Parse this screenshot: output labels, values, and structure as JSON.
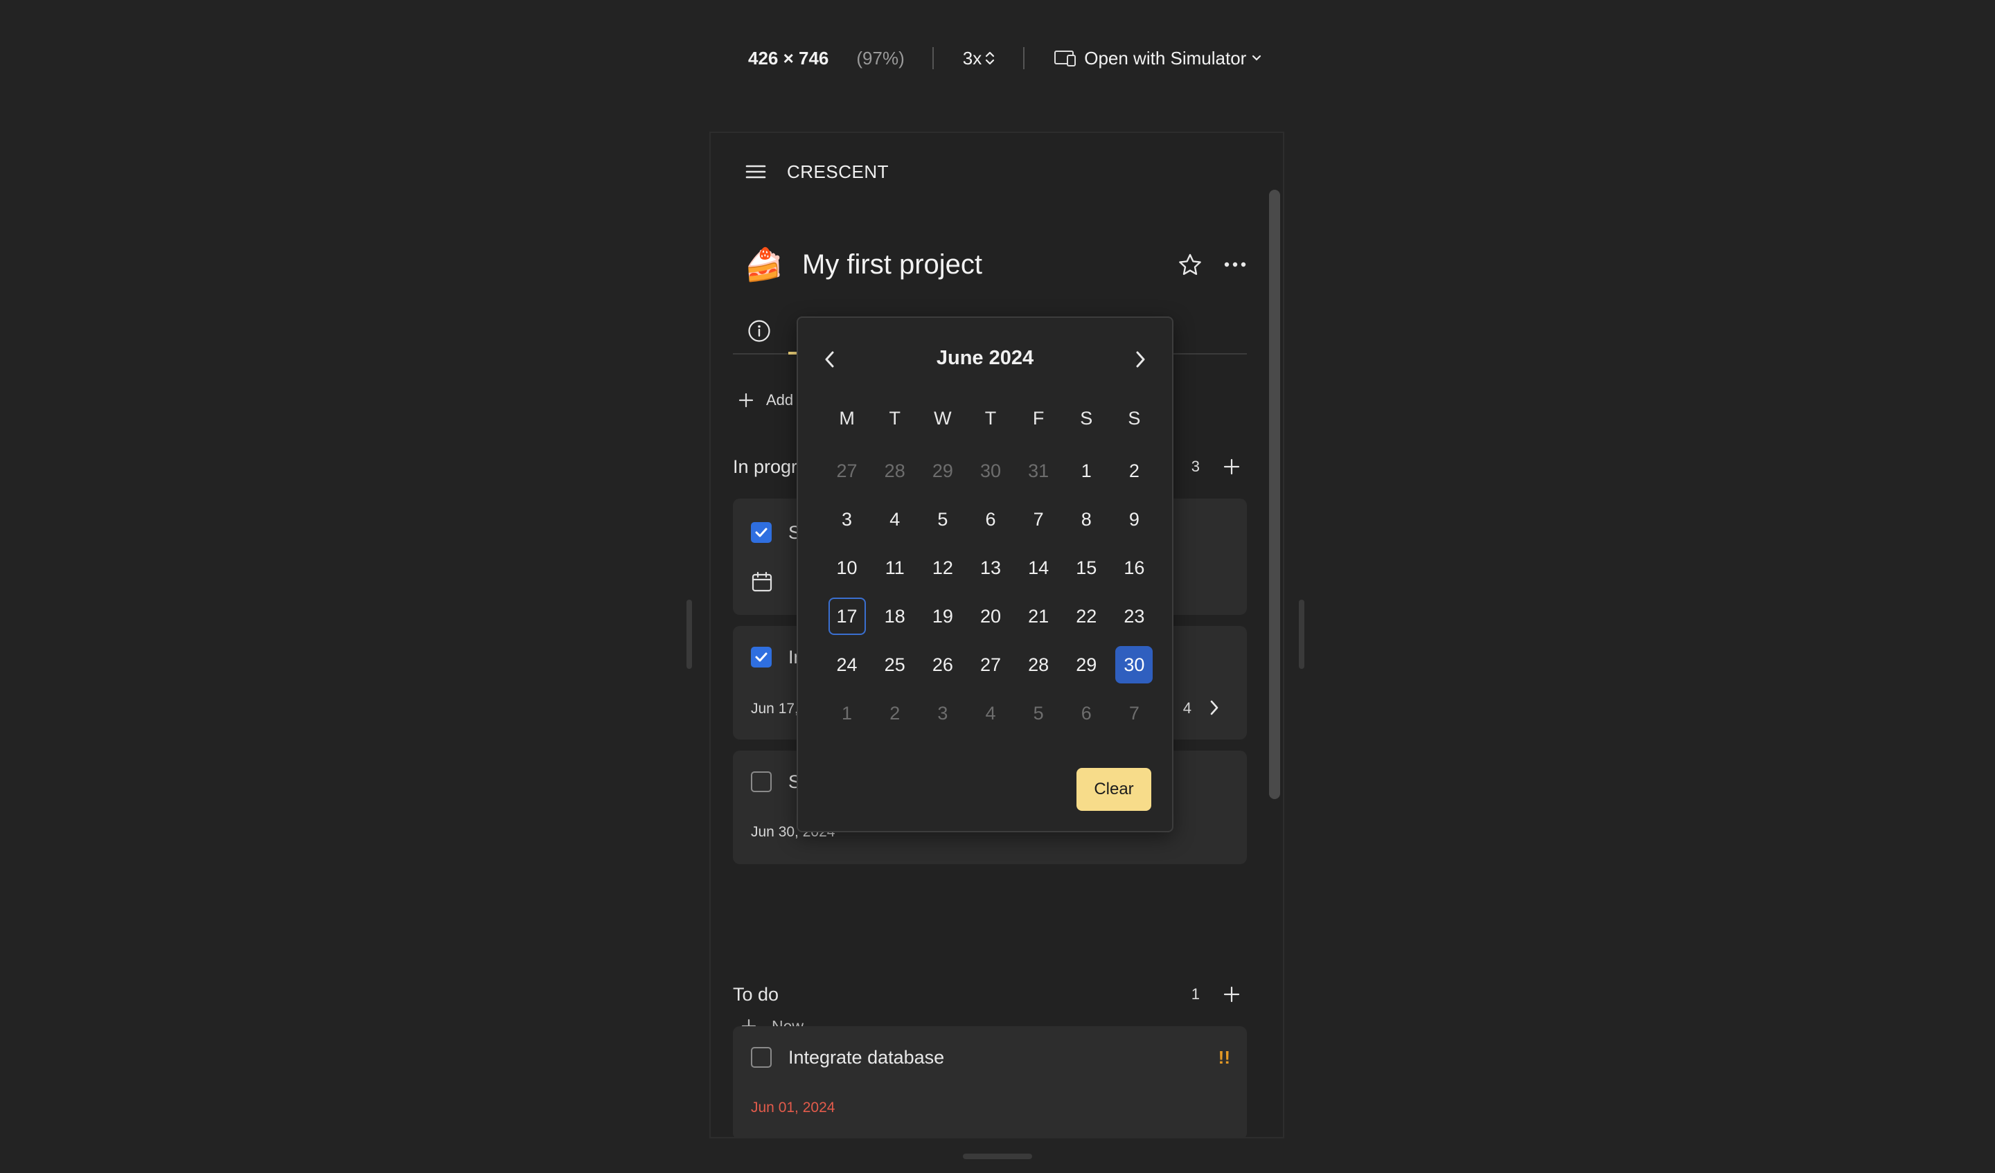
{
  "toolbar": {
    "dimensions": "426 × 746",
    "zoom": "(97%)",
    "scale": "3x",
    "open_with": "Open with Simulator"
  },
  "app": {
    "title": "CRESCENT"
  },
  "project": {
    "emoji": "🍰",
    "title": "My first project"
  },
  "add_row": {
    "label": "Add"
  },
  "sections": [
    {
      "title": "In progr",
      "count": "3",
      "cards": [
        {
          "title": "S",
          "checked": true,
          "date": ""
        },
        {
          "title": "In",
          "checked": true,
          "date": "Jun 17,",
          "subtask_count": "4"
        },
        {
          "title": "S",
          "checked": false,
          "date": "Jun 30, 2024"
        }
      ],
      "new_label": "New"
    },
    {
      "title": "To do",
      "count": "1",
      "cards": [
        {
          "title": "Integrate database",
          "checked": false,
          "date": "Jun 01, 2024",
          "priority": "!!"
        }
      ]
    }
  ],
  "datepicker": {
    "month": "June 2024",
    "weekdays": [
      "M",
      "T",
      "W",
      "T",
      "F",
      "S",
      "S"
    ],
    "days": [
      {
        "d": "27",
        "muted": true
      },
      {
        "d": "28",
        "muted": true
      },
      {
        "d": "29",
        "muted": true
      },
      {
        "d": "30",
        "muted": true
      },
      {
        "d": "31",
        "muted": true
      },
      {
        "d": "1"
      },
      {
        "d": "2"
      },
      {
        "d": "3"
      },
      {
        "d": "4"
      },
      {
        "d": "5"
      },
      {
        "d": "6"
      },
      {
        "d": "7"
      },
      {
        "d": "8"
      },
      {
        "d": "9"
      },
      {
        "d": "10"
      },
      {
        "d": "11"
      },
      {
        "d": "12"
      },
      {
        "d": "13"
      },
      {
        "d": "14"
      },
      {
        "d": "15"
      },
      {
        "d": "16"
      },
      {
        "d": "17",
        "today": true
      },
      {
        "d": "18"
      },
      {
        "d": "19"
      },
      {
        "d": "20"
      },
      {
        "d": "21"
      },
      {
        "d": "22"
      },
      {
        "d": "23"
      },
      {
        "d": "24"
      },
      {
        "d": "25"
      },
      {
        "d": "26"
      },
      {
        "d": "27"
      },
      {
        "d": "28"
      },
      {
        "d": "29"
      },
      {
        "d": "30",
        "selected": true
      },
      {
        "d": "1",
        "muted": true
      },
      {
        "d": "2",
        "muted": true
      },
      {
        "d": "3",
        "muted": true
      },
      {
        "d": "4",
        "muted": true
      },
      {
        "d": "5",
        "muted": true
      },
      {
        "d": "6",
        "muted": true
      },
      {
        "d": "7",
        "muted": true
      }
    ],
    "clear_label": "Clear"
  },
  "colors": {
    "accent_yellow": "#f7dc8a",
    "selected_blue": "#2f5fbf",
    "checkbox_blue": "#2f6fe0",
    "overdue_red": "#e25b4b",
    "priority_orange": "#e69a25"
  }
}
